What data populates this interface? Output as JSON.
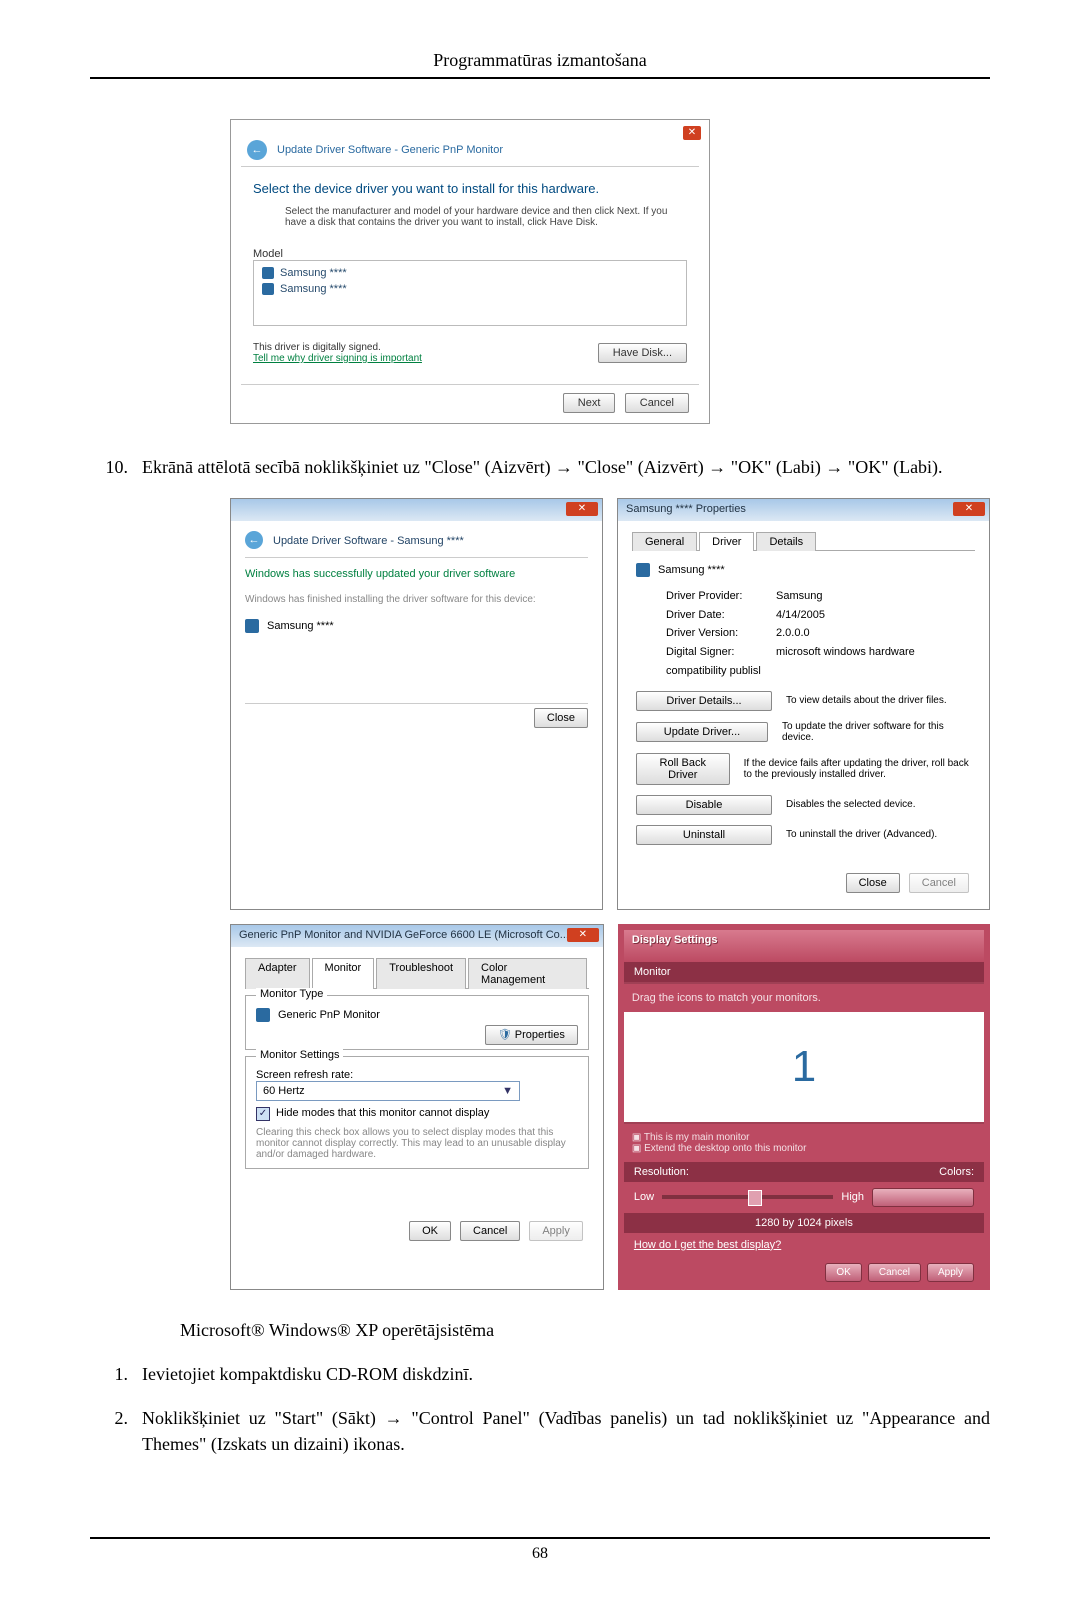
{
  "header": {
    "title": "Programmatūras izmantošana"
  },
  "dialog1": {
    "breadcrumb": "Update Driver Software - Generic PnP Monitor",
    "headline": "Select the device driver you want to install for this hardware.",
    "desc": "Select the manufacturer and model of your hardware device and then click Next. If you have a disk that contains the driver you want to install, click Have Disk.",
    "model_label": "Model",
    "model_items": [
      "Samsung ****",
      "Samsung ****"
    ],
    "signed_text": "This driver is digitally signed.",
    "signed_link": "Tell me why driver signing is important",
    "have_disk": "Have Disk...",
    "next": "Next",
    "cancel": "Cancel"
  },
  "step10": {
    "num": "10.",
    "body": "Ekrānā attēlotā secībā noklikšķiniet uz \"Close\" (Aizvērt) → \"Close\" (Aizvērt) → \"OK\" (Labi) → \"OK\" (Labi)."
  },
  "dlg_update_done": {
    "title": "Update Driver Software - Samsung ****",
    "headline": "Windows has successfully updated your driver software",
    "sub": "Windows has finished installing the driver software for this device:",
    "device": "Samsung ****",
    "close": "Close"
  },
  "dlg_props": {
    "title": "Samsung **** Properties",
    "tabs": [
      "General",
      "Driver",
      "Details"
    ],
    "device": "Samsung ****",
    "fields": {
      "provider_label": "Driver Provider:",
      "provider_value": "Samsung",
      "date_label": "Driver Date:",
      "date_value": "4/14/2005",
      "version_label": "Driver Version:",
      "version_value": "2.0.0.0",
      "signer_label": "Digital Signer:",
      "signer_value": "microsoft windows hardware compatibility publisl"
    },
    "buttons": {
      "details": {
        "label": "Driver Details...",
        "desc": "To view details about the driver files."
      },
      "update": {
        "label": "Update Driver...",
        "desc": "To update the driver software for this device."
      },
      "rollback": {
        "label": "Roll Back Driver",
        "desc": "If the device fails after updating the driver, roll back to the previously installed driver."
      },
      "disable": {
        "label": "Disable",
        "desc": "Disables the selected device."
      },
      "uninstall": {
        "label": "Uninstall",
        "desc": "To uninstall the driver (Advanced)."
      }
    },
    "close": "Close",
    "cancel": "Cancel"
  },
  "dlg_monitor": {
    "title": "Generic PnP Monitor and NVIDIA GeForce 6600 LE (Microsoft Co...",
    "tabs": [
      "Adapter",
      "Monitor",
      "Troubleshoot",
      "Color Management"
    ],
    "type_label": "Monitor Type",
    "type_value": "Generic PnP Monitor",
    "properties_btn": "Properties",
    "settings_label": "Monitor Settings",
    "refresh_label": "Screen refresh rate:",
    "refresh_value": "60 Hertz",
    "hide_checkbox": "Hide modes that this monitor cannot display",
    "hide_desc": "Clearing this check box allows you to select display modes that this monitor cannot display correctly. This may lead to an unusable display and/or damaged hardware.",
    "ok": "OK",
    "cancel": "Cancel",
    "apply": "Apply"
  },
  "gl_panel": {
    "title": "Display Settings",
    "tab": "Monitor",
    "drag_text": "Drag the icons to match your monitors.",
    "num": "1",
    "checkbox1": "This is my main monitor",
    "checkbox2": "Extend the desktop onto this monitor",
    "res_label": "Resolution:",
    "colors_label": "Colors:",
    "low": "Low",
    "high": "High",
    "res_value": "1280 by 1024 pixels",
    "link": "How do I get the best display?",
    "ok": "OK",
    "cancel": "Cancel",
    "apply": "Apply"
  },
  "os_line": "Microsoft® Windows® XP operētājsistēma",
  "step1": {
    "num": "1.",
    "body": "Ievietojiet kompaktdisku CD-ROM diskdzinī."
  },
  "step2": {
    "num": "2.",
    "body": "Noklikšķiniet uz \"Start\" (Sākt) → \"Control Panel\" (Vadības panelis) un tad noklikšķiniet uz \"Appearance and Themes\" (Izskats un dizaini) ikonas."
  },
  "page_number": "68"
}
